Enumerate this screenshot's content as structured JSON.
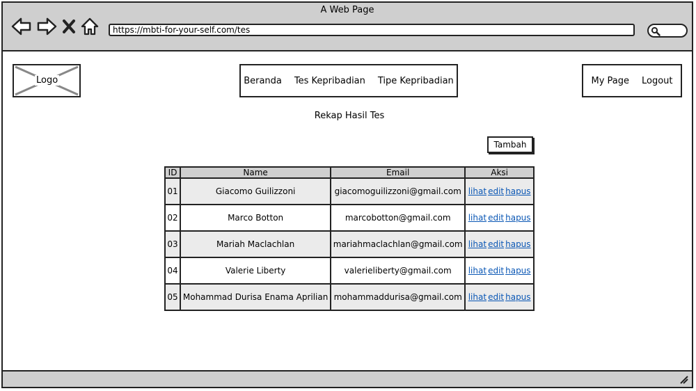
{
  "window": {
    "title": "A Web Page"
  },
  "browser": {
    "url": "https://mbti-for-your-self.com/tes",
    "icons": [
      "back-icon",
      "forward-icon",
      "stop-icon",
      "home-icon",
      "search-icon"
    ]
  },
  "header": {
    "logo_label": "Logo",
    "nav": [
      "Beranda",
      "Tes Kepribadian",
      "Tipe Kepribadian"
    ],
    "user_nav": [
      "My Page",
      "Logout"
    ]
  },
  "main": {
    "title": "Rekap Hasil Tes",
    "add_button": "Tambah",
    "table": {
      "headers": [
        "ID",
        "Name",
        "Email",
        "Aksi"
      ],
      "actions": [
        "lihat",
        "edit",
        "hapus"
      ],
      "rows": [
        {
          "id": "01",
          "name": "Giacomo Guilizzoni",
          "email": "giacomoguilizzoni@gmail.com"
        },
        {
          "id": "02",
          "name": "Marco Botton",
          "email": "marcobotton@gmail.com"
        },
        {
          "id": "03",
          "name": "Mariah Maclachlan",
          "email": "mariahmaclachlan@gmail.com"
        },
        {
          "id": "04",
          "name": "Valerie Liberty",
          "email": "valerieliberty@gmail.com"
        },
        {
          "id": "05",
          "name": "Mohammad Durisa Enama Aprilian",
          "email": "mohammaddurisa@gmail.com"
        }
      ]
    }
  },
  "colors": {
    "link": "#0a57b5",
    "chrome": "#cfcfcf",
    "row_alt": "#ebebeb",
    "border": "#222222"
  }
}
